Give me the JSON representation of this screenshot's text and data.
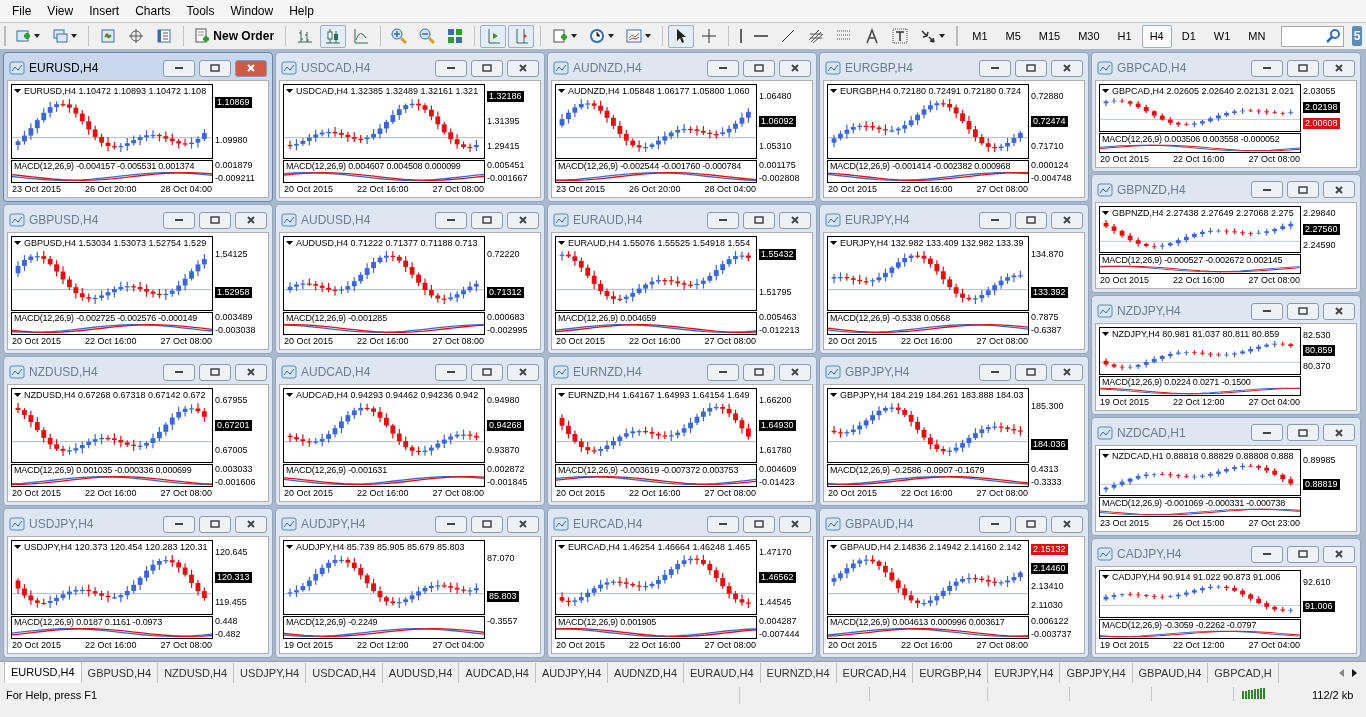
{
  "menu": [
    "File",
    "View",
    "Insert",
    "Charts",
    "Tools",
    "Window",
    "Help"
  ],
  "toolbar": [
    {
      "kind": "new-chart",
      "pressed": false
    },
    {
      "kind": "profiles",
      "pressed": false
    },
    {
      "kind": "separator"
    },
    {
      "kind": "market-watch",
      "pressed": false
    },
    {
      "kind": "navigator",
      "pressed": false
    },
    {
      "kind": "terminal",
      "pressed": false
    },
    {
      "kind": "separator"
    },
    {
      "kind": "new-order",
      "label": "New Order",
      "pressed": false
    },
    {
      "kind": "separator"
    },
    {
      "kind": "bar-chart",
      "pressed": false
    },
    {
      "kind": "candlesticks",
      "pressed": true
    },
    {
      "kind": "line-chart",
      "pressed": false
    },
    {
      "kind": "separator"
    },
    {
      "kind": "zoom-in",
      "pressed": false
    },
    {
      "kind": "zoom-out",
      "pressed": false
    },
    {
      "kind": "tile",
      "pressed": false
    },
    {
      "kind": "separator"
    },
    {
      "kind": "auto-scroll",
      "pressed": true
    },
    {
      "kind": "chart-shift",
      "pressed": true
    },
    {
      "kind": "separator"
    },
    {
      "kind": "indicators",
      "pressed": false
    },
    {
      "kind": "periods",
      "pressed": false
    },
    {
      "kind": "templates",
      "pressed": false
    },
    {
      "kind": "separator"
    },
    {
      "kind": "cursor",
      "pressed": true
    },
    {
      "kind": "crosshair",
      "pressed": false
    },
    {
      "kind": "separator"
    },
    {
      "kind": "vertical-line",
      "pressed": false
    },
    {
      "kind": "horizontal-line",
      "pressed": false
    },
    {
      "kind": "trendline",
      "pressed": false
    },
    {
      "kind": "fibo-channel",
      "pressed": false
    },
    {
      "kind": "fibo-levels",
      "pressed": false
    },
    {
      "kind": "text",
      "pressed": false
    },
    {
      "kind": "text-label",
      "pressed": false
    },
    {
      "kind": "arrows",
      "pressed": false
    }
  ],
  "timeframes": [
    {
      "label": "M1",
      "selected": false
    },
    {
      "label": "M5",
      "selected": false
    },
    {
      "label": "M15",
      "selected": false
    },
    {
      "label": "M30",
      "selected": false
    },
    {
      "label": "H1",
      "selected": false
    },
    {
      "label": "H4",
      "selected": true
    },
    {
      "label": "D1",
      "selected": false
    },
    {
      "label": "W1",
      "selected": false
    },
    {
      "label": "MN",
      "selected": false
    }
  ],
  "mail_badge": "5",
  "columns": [
    [
      {
        "title": "EURUSD,H4",
        "active": true,
        "header": "EURUSD,H4  1.10472 1.10893 1.10472 1.108",
        "scale": [
          {
            "text": "1.10869",
            "kind": "current"
          },
          {
            "text": "1.09980",
            "kind": "plain"
          }
        ],
        "macd": "MACD(12,26,9) -0.004157 -0.005531 0.001374",
        "macd_scale": [
          "0.001879",
          "-0.009211"
        ],
        "times": [
          "23 Oct 2015",
          "26 Oct 20:00",
          "28 Oct 04:00"
        ]
      },
      {
        "title": "GBPUSD,H4",
        "active": false,
        "header": "GBPUSD,H4  1.53034 1.53073 1.52754 1.529",
        "scale": [
          {
            "text": "1.54125",
            "kind": "plain"
          },
          {
            "text": "1.52958",
            "kind": "current"
          }
        ],
        "macd": "MACD(12,26,9) -0.002725 -0.002576 -0.000149",
        "macd_scale": [
          "0.003489",
          "-0.003038"
        ],
        "times": [
          "20 Oct 2015",
          "22 Oct 16:00",
          "27 Oct 08:00"
        ]
      },
      {
        "title": "NZDUSD,H4",
        "active": false,
        "header": "NZDUSD,H4  0.67268 0.67318 0.67142 0.672",
        "scale": [
          {
            "text": "0.67955",
            "kind": "plain"
          },
          {
            "text": "0.67201",
            "kind": "current"
          },
          {
            "text": "0.67005",
            "kind": "plain"
          }
        ],
        "macd": "MACD(12,26,9) 0.001035 -0.000336 0.000699",
        "macd_scale": [
          "0.003033",
          "-0.001606"
        ],
        "times": [
          "20 Oct 2015",
          "22 Oct 16:00",
          "27 Oct 08:00"
        ]
      },
      {
        "title": "USDJPY,H4",
        "active": false,
        "header": "USDJPY,H4  120.373 120.454 120.283 120.31",
        "scale": [
          {
            "text": "120.645",
            "kind": "plain"
          },
          {
            "text": "120.313",
            "kind": "current"
          },
          {
            "text": "119.455",
            "kind": "plain"
          }
        ],
        "macd": "MACD(12,26,9) 0.0187 0.1161 -0.0973",
        "macd_scale": [
          "0.448",
          "-0.482"
        ],
        "times": [
          "20 Oct 2015",
          "22 Oct 16:00",
          "27 Oct 08:00"
        ]
      }
    ],
    [
      {
        "title": "USDCAD,H4",
        "active": false,
        "header": "USDCAD,H4  1.32385 1.32489 1.32161 1.321",
        "scale": [
          {
            "text": "1.32186",
            "kind": "current"
          },
          {
            "text": "1.31395",
            "kind": "plain"
          },
          {
            "text": "1.29415",
            "kind": "plain"
          }
        ],
        "macd": "MACD(12,26,9) 0.004607 0.004508 0.000099",
        "macd_scale": [
          "0.005451",
          "-0.001667"
        ],
        "times": [
          "20 Oct 2015",
          "22 Oct 16:00",
          "27 Oct 08:00"
        ]
      },
      {
        "title": "AUDUSD,H4",
        "active": false,
        "header": "AUDUSD,H4  0.71222 0.71377 0.71188 0.713",
        "scale": [
          {
            "text": "0.72220",
            "kind": "plain"
          },
          {
            "text": "0.71312",
            "kind": "current"
          }
        ],
        "macd": "MACD(12,26,9) -0.001285",
        "macd_scale": [
          "0.000683",
          "-0.002995"
        ],
        "times": [
          "20 Oct 2015",
          "22 Oct 16:00",
          "27 Oct 08:00"
        ]
      },
      {
        "title": "AUDCAD,H4",
        "active": false,
        "header": "AUDCAD,H4  0.94293 0.94462 0.94236 0.942",
        "scale": [
          {
            "text": "0.94980",
            "kind": "plain"
          },
          {
            "text": "0.94268",
            "kind": "current"
          },
          {
            "text": "0.93870",
            "kind": "plain"
          }
        ],
        "macd": "MACD(12,26,9) -0.001631",
        "macd_scale": [
          "0.002872",
          "-0.001845"
        ],
        "times": [
          "20 Oct 2015",
          "22 Oct 16:00",
          "27 Oct 08:00"
        ]
      },
      {
        "title": "AUDJPY,H4",
        "active": false,
        "header": "AUDJPY,H4  85.739 85.905 85.679 85.803",
        "scale": [
          {
            "text": "87.070",
            "kind": "plain"
          },
          {
            "text": "85.803",
            "kind": "current"
          }
        ],
        "macd": "MACD(12,26,9) -0.2249",
        "macd_scale": [
          "-0.3557"
        ],
        "times": [
          "19 Oct 2015",
          "22 Oct 12:00",
          "27 Oct 04:00"
        ]
      }
    ],
    [
      {
        "title": "AUDNZD,H4",
        "active": false,
        "header": "AUDNZD,H4  1.05848 1.06177 1.05800 1.060",
        "scale": [
          {
            "text": "1.06480",
            "kind": "plain"
          },
          {
            "text": "1.06092",
            "kind": "current"
          },
          {
            "text": "1.05310",
            "kind": "plain"
          }
        ],
        "macd": "MACD(12,26,9) -0.002544 -0.001760 -0.000784",
        "macd_scale": [
          "0.001175",
          "-0.002808"
        ],
        "times": [
          "23 Oct 2015",
          "26 Oct 20:00",
          "28 Oct 04:00"
        ]
      },
      {
        "title": "EURAUD,H4",
        "active": false,
        "header": "EURAUD,H4  1.55076 1.55525 1.54918 1.554",
        "scale": [
          {
            "text": "1.55432",
            "kind": "current"
          },
          {
            "text": "1.51795",
            "kind": "plain"
          }
        ],
        "macd": "MACD(12,26,9) 0.004659",
        "macd_scale": [
          "0.005463",
          "-0.012213"
        ],
        "times": [
          "20 Oct 2015",
          "22 Oct 16:00",
          "27 Oct 08:00"
        ]
      },
      {
        "title": "EURNZD,H4",
        "active": false,
        "header": "EURNZD,H4  1.64167 1.64993 1.64154 1.649",
        "scale": [
          {
            "text": "1.66200",
            "kind": "plain"
          },
          {
            "text": "1.64930",
            "kind": "current"
          },
          {
            "text": "1.61780",
            "kind": "plain"
          }
        ],
        "macd": "MACD(12,26,9) -0.003619 -0.007372 0.003753",
        "macd_scale": [
          "0.004609",
          "-0.01423"
        ],
        "times": [
          "20 Oct 2015",
          "22 Oct 16:00",
          "27 Oct 08:00"
        ]
      },
      {
        "title": "EURCAD,H4",
        "active": false,
        "header": "EURCAD,H4  1.46254 1.46664 1.46248 1.465",
        "scale": [
          {
            "text": "1.47170",
            "kind": "plain"
          },
          {
            "text": "1.46562",
            "kind": "current"
          },
          {
            "text": "1.44545",
            "kind": "plain"
          }
        ],
        "macd": "MACD(12,26,9) 0.001905",
        "macd_scale": [
          "0.004287",
          "-0.007444"
        ],
        "times": [
          "20 Oct 2015",
          "22 Oct 16:00",
          "27 Oct 08:00"
        ]
      }
    ],
    [
      {
        "title": "EURGBP,H4",
        "active": false,
        "header": "EURGBP,H4  0.72180 0.72491 0.72180 0.724",
        "scale": [
          {
            "text": "0.72880",
            "kind": "plain"
          },
          {
            "text": "0.72474",
            "kind": "current"
          },
          {
            "text": "0.71710",
            "kind": "plain"
          }
        ],
        "macd": "MACD(12,26,9) -0.001414 -0.002382 0.000968",
        "macd_scale": [
          "0.000124",
          "-0.004748"
        ],
        "times": [
          "20 Oct 2015",
          "22 Oct 16:00",
          "27 Oct 08:00"
        ]
      },
      {
        "title": "EURJPY,H4",
        "active": false,
        "header": "EURJPY,H4  132.982 133.409 132.982 133.39",
        "scale": [
          {
            "text": "134.870",
            "kind": "plain"
          },
          {
            "text": "133.392",
            "kind": "current"
          }
        ],
        "macd": "MACD(12,26,9) -0.5338 0.0568",
        "macd_scale": [
          "0.7875",
          "-0.6387"
        ],
        "times": [
          "20 Oct 2015",
          "22 Oct 16:00",
          "27 Oct 08:00"
        ]
      },
      {
        "title": "GBPJPY,H4",
        "active": false,
        "header": "GBPJPY,H4  184.219 184.261 183.888 184.03",
        "scale": [
          {
            "text": "185.300",
            "kind": "plain"
          },
          {
            "text": "184.036",
            "kind": "current"
          }
        ],
        "macd": "MACD(12,26,9) -0.2586 -0.0907 -0.1679",
        "macd_scale": [
          "0.4313",
          "-0.3333"
        ],
        "times": [
          "20 Oct 2015",
          "22 Oct 16:00",
          "27 Oct 08:00"
        ]
      },
      {
        "title": "GBPAUD,H4",
        "active": false,
        "header": "GBPAUD,H4  2.14836 2.14942 2.14160 2.142",
        "scale": [
          {
            "text": "2.15132",
            "kind": "alert"
          },
          {
            "text": "2.14460",
            "kind": "current"
          },
          {
            "text": "2.13410",
            "kind": "plain"
          },
          {
            "text": "2.11030",
            "kind": "plain"
          }
        ],
        "macd": "MACD(12,26,9) 0.004613 0.000996 0.003617",
        "macd_scale": [
          "0.006122",
          "-0.003737"
        ],
        "times": [
          "20 Oct 2015",
          "22 Oct 16:00",
          "27 Oct 08:00"
        ]
      }
    ],
    [
      {
        "title": "GBPCAD,H4",
        "active": false,
        "header": "GBPCAD,H4  2.02605 2.02640 2.02131 2.021",
        "scale": [
          {
            "text": "2.03055",
            "kind": "plain"
          },
          {
            "text": "2.02198",
            "kind": "current"
          },
          {
            "text": "2.00608",
            "kind": "alert"
          }
        ],
        "macd": "MACD(12,26,9) 0.003506 0.003558 -0.000052",
        "times": [
          "20 Oct 2015",
          "22 Oct 16:00",
          "27 Oct 08:00"
        ]
      },
      {
        "title": "GBPNZD,H4",
        "active": false,
        "header": "GBPNZD,H4  2.27438 2.27649 2.27068 2.275",
        "scale": [
          {
            "text": "2.29840",
            "kind": "plain"
          },
          {
            "text": "2.27560",
            "kind": "current"
          },
          {
            "text": "2.24590",
            "kind": "plain"
          }
        ],
        "macd": "MACD(12,26,9) -0.000527 -0.002672 0.002145",
        "times": [
          "20 Oct 2015",
          "22 Oct 16:00",
          "27 Oct 08:00"
        ]
      },
      {
        "title": "NZDJPY,H4",
        "active": false,
        "header": "NZDJPY,H4  80.981 81.037 80.811 80.859",
        "scale": [
          {
            "text": "82.530",
            "kind": "plain"
          },
          {
            "text": "80.859",
            "kind": "current"
          },
          {
            "text": "80.370",
            "kind": "plain"
          }
        ],
        "macd": "MACD(12,26,9) 0.0224 0.0271 -0.1500",
        "times": [
          "19 Oct 2015",
          "22 Oct 12:00",
          "27 Oct 04:00"
        ]
      },
      {
        "title": "NZDCAD,H1",
        "active": false,
        "header": "NZDCAD,H1  0.88818 0.88829 0.88808 0.888",
        "scale": [
          {
            "text": "0.89985",
            "kind": "plain"
          },
          {
            "text": "0.88819",
            "kind": "current"
          }
        ],
        "macd": "MACD(12,26,9) -0.001069 -0.000331 -0.000738",
        "times": [
          "23 Oct 2015",
          "26 Oct 15:00",
          "27 Oct 23:00"
        ]
      },
      {
        "title": "CADJPY,H4",
        "active": false,
        "header": "CADJPY,H4  90.914 91.022 90.873 91.006",
        "scale": [
          {
            "text": "92.610",
            "kind": "plain"
          },
          {
            "text": "91.006",
            "kind": "current"
          }
        ],
        "macd": "MACD(12,26,9) -0.3059 -0.2262 -0.0797",
        "times": [
          "19 Oct 2015",
          "22 Oct 12:00",
          "27 Oct 04:00"
        ]
      }
    ]
  ],
  "tabs": [
    {
      "label": "EURUSD,H4",
      "selected": true
    },
    {
      "label": "GBPUSD,H4",
      "selected": false
    },
    {
      "label": "NZDUSD,H4",
      "selected": false
    },
    {
      "label": "USDJPY,H4",
      "selected": false
    },
    {
      "label": "USDCAD,H4",
      "selected": false
    },
    {
      "label": "AUDUSD,H4",
      "selected": false
    },
    {
      "label": "AUDCAD,H4",
      "selected": false
    },
    {
      "label": "AUDJPY,H4",
      "selected": false
    },
    {
      "label": "AUDNZD,H4",
      "selected": false
    },
    {
      "label": "EURAUD,H4",
      "selected": false
    },
    {
      "label": "EURNZD,H4",
      "selected": false
    },
    {
      "label": "EURCAD,H4",
      "selected": false
    },
    {
      "label": "EURGBP,H4",
      "selected": false
    },
    {
      "label": "EURJPY,H4",
      "selected": false
    },
    {
      "label": "GBPJPY,H4",
      "selected": false
    },
    {
      "label": "GBPAUD,H4",
      "selected": false
    },
    {
      "label": "GBPCAD,H",
      "selected": false
    }
  ],
  "status_bar": {
    "help": "For Help, press F1",
    "traffic": "112/2 kb"
  }
}
